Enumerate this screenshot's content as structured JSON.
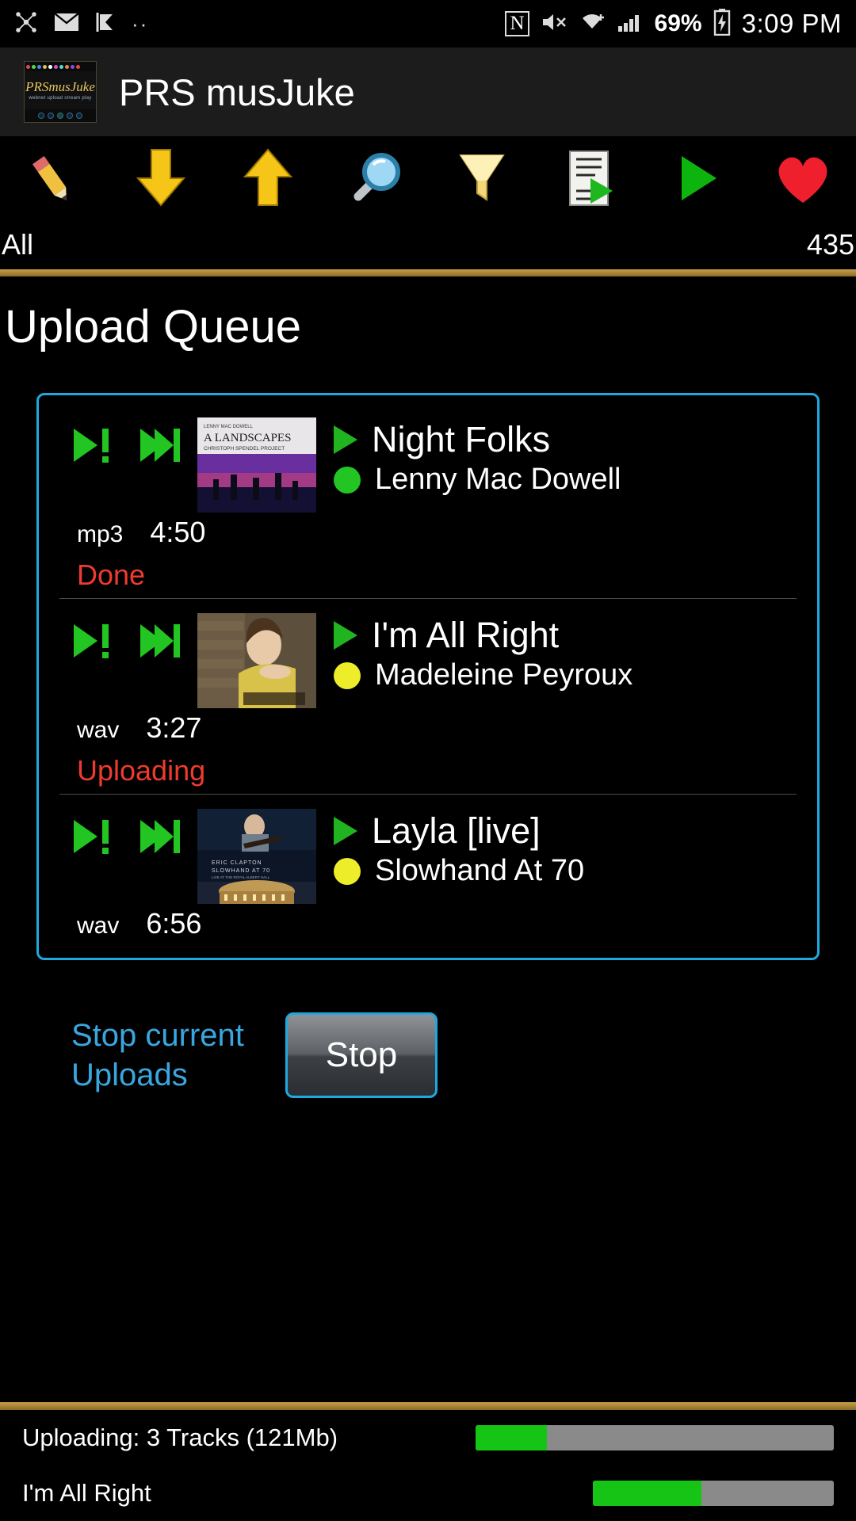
{
  "statusbar": {
    "icons_left": [
      "cluster-icon",
      "mail-icon",
      "check-flag-icon",
      "more-dots-icon"
    ],
    "nfc": "N",
    "mute": "mute-icon",
    "wifi": "wifi-icon",
    "signal": "signal-icon",
    "battery_percent": "69%",
    "battery": "battery-charging-icon",
    "time": "3:09 PM"
  },
  "appbar": {
    "title": "PRS musJuke",
    "logo_title": "PRSmusJuke",
    "logo_subtitle": "webnet upload stream play"
  },
  "toolbar": {
    "items": [
      {
        "name": "edit-pencil-icon",
        "label": "Edit"
      },
      {
        "name": "download-arrow-icon",
        "label": "Download"
      },
      {
        "name": "upload-arrow-icon",
        "label": "Upload"
      },
      {
        "name": "search-magnifier-icon",
        "label": "Search"
      },
      {
        "name": "filter-funnel-icon",
        "label": "Filter"
      },
      {
        "name": "playlist-icon",
        "label": "Playlist"
      },
      {
        "name": "play-icon",
        "label": "Play"
      },
      {
        "name": "favourite-heart-icon",
        "label": "Favourites"
      }
    ]
  },
  "filterbar": {
    "scope": "All",
    "count": "435"
  },
  "page": {
    "title": "Upload Queue"
  },
  "queue": {
    "rows": [
      {
        "title": "Night Folks",
        "artist": "Lenny Mac Dowell",
        "format": "mp3",
        "duration": "4:50",
        "status": "Done",
        "dot_color": "#22c522",
        "art_alt": "A Landscapes Custom Spirit Project album cover"
      },
      {
        "title": "I'm All Right",
        "artist": "Madeleine Peyroux",
        "format": "wav",
        "duration": "3:27",
        "status": "Uploading",
        "dot_color": "#eded2a",
        "art_alt": "Madeleine Peyroux album cover"
      },
      {
        "title": "Layla [live]",
        "artist": "Slowhand At 70",
        "format": "wav",
        "duration": "6:56",
        "status": "",
        "dot_color": "#eded2a",
        "art_alt": "Eric Clapton Slowhand At 70 Live at the Royal Albert Hall cover"
      }
    ]
  },
  "stop": {
    "label": "Stop current Uploads",
    "button": "Stop"
  },
  "footer": {
    "overall_label": "Uploading: 3 Tracks (121Mb)",
    "overall_progress": 20,
    "current_label": "I'm All Right",
    "current_progress": 45
  },
  "colors": {
    "accent_blue": "#1fa8e0",
    "status_red": "#ef3b2d",
    "gold": "#c9a04a",
    "progress_green": "#16c416"
  }
}
